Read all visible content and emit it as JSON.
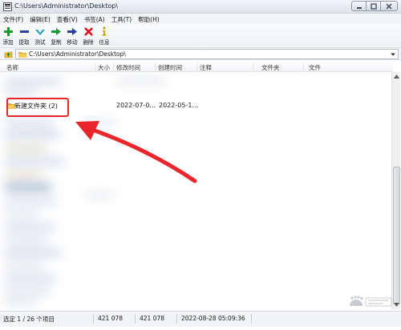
{
  "window": {
    "title": "C:\\Users\\Administrator\\Desktop\\"
  },
  "menu": {
    "items": [
      "文件(F)",
      "编辑(E)",
      "查看(V)",
      "书签(A)",
      "工具(T)",
      "帮助(H)"
    ]
  },
  "toolbar": {
    "items": [
      {
        "label": "添加",
        "icon": "plus-icon",
        "color": "#1c9a2a"
      },
      {
        "label": "提取",
        "icon": "minus-icon",
        "color": "#2a3f9e"
      },
      {
        "label": "测试",
        "icon": "check-icon",
        "color": "#2b9fbf"
      },
      {
        "label": "复制",
        "icon": "copy-arrow-icon",
        "color": "#1a9a3a"
      },
      {
        "label": "移动",
        "icon": "move-arrow-icon",
        "color": "#2a3f9e"
      },
      {
        "label": "删除",
        "icon": "delete-x-icon",
        "color": "#d4141c"
      },
      {
        "label": "信息",
        "icon": "info-icon",
        "color": "#c9a400"
      }
    ]
  },
  "address": {
    "path": "C:\\Users\\Administrator\\Desktop\\"
  },
  "columns": {
    "name": "名称",
    "size": "大小",
    "modified": "修改时间",
    "created": "创建时间",
    "comment": "注释",
    "folders": "文件夹",
    "files": "文件"
  },
  "selected_row": {
    "name": "新建文件夹 (2)",
    "modified": "2022-07-0...",
    "created": "2022-05-1..."
  },
  "status": {
    "selection": "选定 1 / 26 个项目",
    "size": "421 078",
    "packed": "421 078",
    "datetime": "2022-08-28 05:09:36"
  },
  "colors": {
    "annotation_red": "#e8262b",
    "folder_yellow": "#f0c040"
  },
  "watermark": {
    "logo": "baidu-jingyan-logo"
  }
}
